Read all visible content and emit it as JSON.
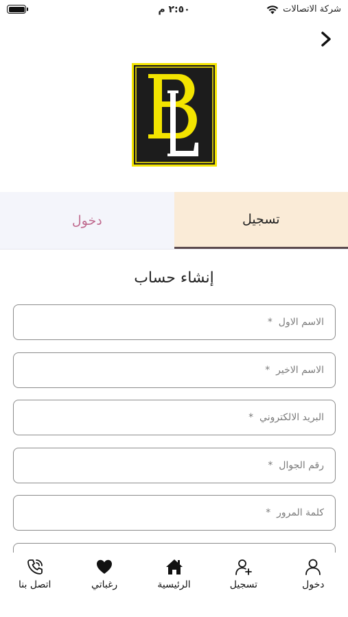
{
  "status_bar": {
    "carrier": "شركة الاتصالات",
    "time": "٢:٥٠ م"
  },
  "tabs": {
    "login_label": "دخول",
    "register_label": "تسجيل",
    "active": "register"
  },
  "form": {
    "title": "إنشاء حساب",
    "fields": [
      {
        "placeholder": "الاسم الاول  *",
        "value": ""
      },
      {
        "placeholder": "الاسم الاخير  *",
        "value": ""
      },
      {
        "placeholder": "البريد الالكتروني  *",
        "value": ""
      },
      {
        "placeholder": "رقم الجوال  *",
        "value": ""
      },
      {
        "placeholder": "كلمة المرور  *",
        "value": ""
      }
    ]
  },
  "bottom_nav": {
    "items": [
      {
        "label": "اتصل بنا",
        "icon": "phone-icon"
      },
      {
        "label": "رغباتي",
        "icon": "heart-icon"
      },
      {
        "label": "الرئيسية",
        "icon": "home-icon"
      },
      {
        "label": "تسجيل",
        "icon": "add-user-icon"
      },
      {
        "label": "دخول",
        "icon": "user-icon"
      }
    ]
  },
  "colors": {
    "register_tab_bg": "#faebd7",
    "login_tab_bg": "#f4f5fb",
    "login_tab_text": "#c06b8f",
    "logo_yellow": "#f3e400",
    "logo_black": "#1c1c1c"
  }
}
